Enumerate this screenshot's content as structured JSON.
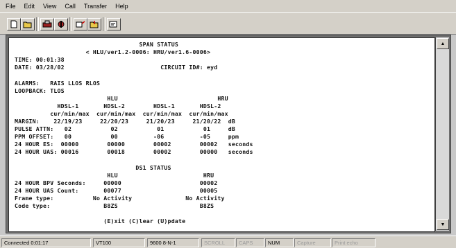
{
  "menu": [
    "File",
    "Edit",
    "View",
    "Call",
    "Transfer",
    "Help"
  ],
  "toolbar_icons": [
    "new-icon",
    "open-icon",
    "disconnect-icon",
    "properties-icon",
    "send-icon",
    "receive-icon",
    "capture-icon"
  ],
  "terminal": {
    "lines": [
      "                                   SPAN STATUS",
      "                    < HLU/ver1.2-0006: HRU/ver1.6-0006>",
      "TIME: 00:01:38",
      "DATE: 03/28/02                           CIRCUIT ID#: eyd",
      "",
      "ALARMS:   RAIS LLOS RLOS",
      "LOOPBACK: TLOS",
      "                          HLU                            HRU",
      "            HDSL-1       HDSL-2        HDSL-1       HDSL-2",
      "          cur/min/max  cur/min/max  cur/min/max  cur/min/max",
      "MARGIN:    22/19/23     22/20/23     21/20/23     21/20/22  dB",
      "PULSE ATTN:   02           02           01           01     dB",
      "PPM OFFSET:   00           00          -06          -05     ppm",
      "24 HOUR ES:  00000        00000        00002        00002   seconds",
      "24 HOUR UAS: 00016        00018        00002        00000   seconds",
      "",
      "                                  DS1 STATUS",
      "                          HLU                        HRU",
      "24 HOUR BPV Seconds:     00000                      00002",
      "24 HOUR UAS Count:       00077                      00005",
      "Frame type:           No Activity               No Activity",
      "Code type:               B8ZS                       B8ZS",
      "",
      "                         (E)xit (C)lear (U)pdate"
    ]
  },
  "scrollbar": {
    "up": "▲",
    "down": "▼"
  },
  "status": {
    "connected": "Connected 0:01:17",
    "emulation": "VT100",
    "settings": "9600 8-N-1",
    "scroll": "SCROLL",
    "caps": "CAPS",
    "num": "NUM",
    "capture": "Capture",
    "printecho": "Print echo"
  }
}
